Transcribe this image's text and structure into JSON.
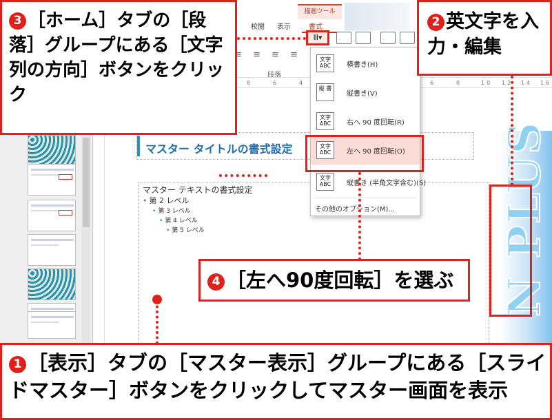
{
  "ribbon": {
    "tabs": [
      "校閲",
      "表示"
    ],
    "context_tab_header": "描画ツール",
    "format_tab": "書式",
    "paragraph_icons": "≡ ≡ ≡ ≡",
    "paragraph_group_label": "段落",
    "ruler_numbers": [
      "8",
      "6",
      "4",
      "2",
      "0",
      "2",
      "4",
      "6",
      "8",
      "10",
      "12",
      "14",
      "16"
    ],
    "text_direction_button": "Ⅲ▾"
  },
  "menu": {
    "items": [
      {
        "icon_text": "文字 ABC",
        "label": "横書き(H)",
        "active": false
      },
      {
        "icon_text": "縦 書",
        "label": "縦書き(V)",
        "active": false
      },
      {
        "icon_text": "文字 ABC",
        "label": "右へ 90 度回転(R)",
        "active": false
      },
      {
        "icon_text": "文字 ABC",
        "label": "左へ 90 度回転(O)",
        "active": true
      },
      {
        "icon_text": "文字 ABC",
        "label": "縦書き (半角文字含む)(S)",
        "active": false
      }
    ],
    "more_options": "その他のオプション(M)..."
  },
  "slide": {
    "title": "マスター タイトルの書式設定",
    "body": {
      "level1": "マスター テキストの書式設定",
      "level2": "第 2 レベル",
      "level3": "第 3 レベル",
      "level4": "第 4 レベル",
      "level5": "第 5 レベル"
    },
    "vertical_text": "N PLUS"
  },
  "callouts": {
    "c3": {
      "num": "3",
      "text": "［ホーム］タブの［段落］グループにある［文字列の方向］ボタンをクリック"
    },
    "c2": {
      "num": "2",
      "text": "英文字を入力・編集"
    },
    "c4": {
      "num": "4",
      "text": "［左へ90度回転］を選ぶ"
    },
    "c1": {
      "num": "1",
      "text": "［表示］タブの［マスター表示］グループにある［スライドマスター］ボタンをクリックしてマスター画面を表示"
    }
  },
  "colors": {
    "accent": "#e0201b",
    "title_blue": "#1f6fb0",
    "menu_active": "#fbdcd6"
  }
}
